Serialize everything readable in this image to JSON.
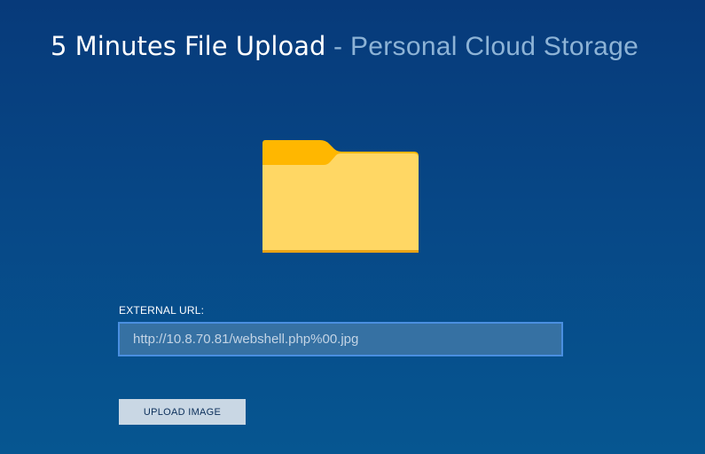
{
  "header": {
    "title": "5 Minutes File Upload",
    "subtitle": "- Personal Cloud Storage"
  },
  "upload_form": {
    "url_label": "EXTERNAL URL:",
    "url_value": "http://10.8.70.81/webshell.php%00.jpg",
    "upload_button_label": "UPLOAD IMAGE"
  },
  "icons": {
    "folder": "folder-icon"
  },
  "colors": {
    "background_top": "#073a7a",
    "background_bottom": "#065691",
    "folder_front": "#ffd764",
    "folder_tab": "#ffb700",
    "input_border": "#4a8fe0",
    "button_bg": "#c9d7e4"
  }
}
